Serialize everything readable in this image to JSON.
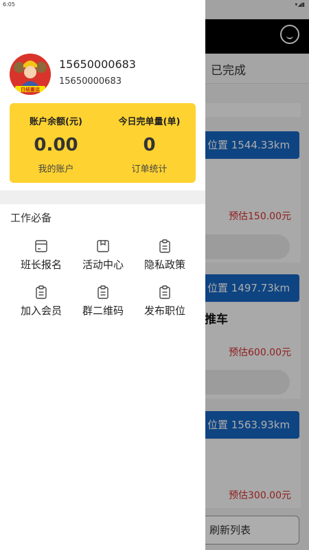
{
  "status_bar": {
    "time": "6:05",
    "icons": "▾◢▮"
  },
  "background_app": {
    "tab_completed": "已完成",
    "cards": [
      {
        "location": "位置 1544.33km",
        "estimate": "预估150.00元"
      },
      {
        "location": "位置 1497.73km",
        "title": "推车",
        "estimate": "预估600.00元"
      },
      {
        "location": "位置 1563.93km",
        "estimate": "预估300.00元"
      }
    ],
    "refresh_button": "刷新列表"
  },
  "drawer": {
    "profile": {
      "phone": "15650000683",
      "account": "15650000683",
      "avatar_text": "日结搬运"
    },
    "stats": {
      "balance_label": "账户余额(元)",
      "balance_value": "0.00",
      "balance_link": "我的账户",
      "orders_label": "今日完单量(单)",
      "orders_value": "0",
      "orders_link": "订单统计"
    },
    "section_title": "工作必备",
    "menu": [
      {
        "label": "班长报名",
        "icon": "card-icon"
      },
      {
        "label": "活动中心",
        "icon": "gift-box-icon"
      },
      {
        "label": "隐私政策",
        "icon": "clipboard-icon"
      },
      {
        "label": "加入会员",
        "icon": "clipboard-icon"
      },
      {
        "label": "群二维码",
        "icon": "clipboard-icon"
      },
      {
        "label": "发布职位",
        "icon": "clipboard-icon"
      }
    ]
  },
  "colors": {
    "accent_yellow": "#fed331",
    "location_blue": "#1565c0",
    "price_red": "#d32f2f",
    "header_black": "#000000"
  }
}
